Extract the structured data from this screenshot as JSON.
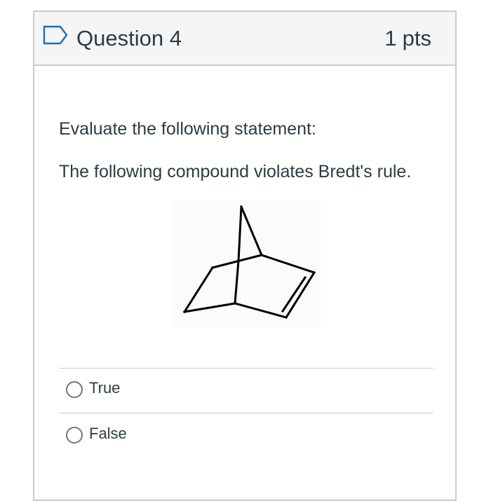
{
  "question": {
    "title": "Question 4",
    "points_value": "1",
    "points_unit": "pts",
    "prompt": "Evaluate the following statement:",
    "statement": "The following compound violates Bredt's rule.",
    "image_icon": "norbornene-structure"
  },
  "answers": [
    {
      "label": "True",
      "selected": false
    },
    {
      "label": "False",
      "selected": false
    }
  ],
  "colors": {
    "text": "#2d3b45",
    "border": "#c7cdd1",
    "header_bg": "#f5f5f5",
    "flag_blue": "#1b6fb6"
  },
  "icons": {
    "flag": "flag-question-icon",
    "radio": "radio-button-icon"
  }
}
